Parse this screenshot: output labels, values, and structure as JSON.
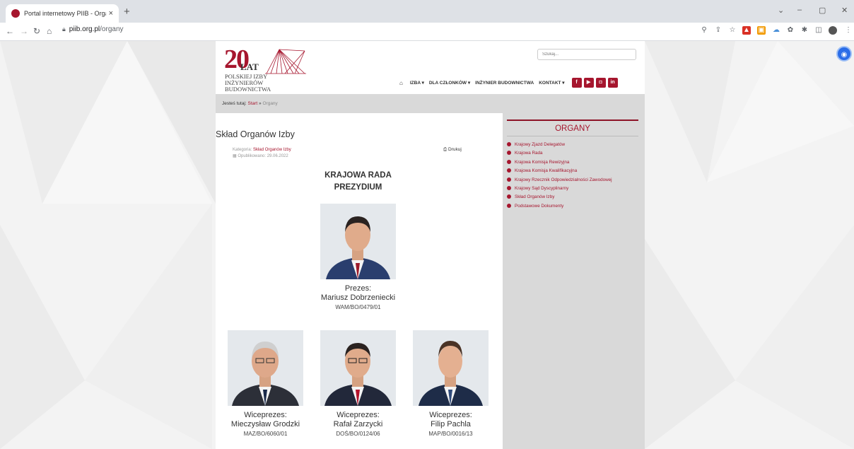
{
  "browser": {
    "tab_title": "Portal internetowy PIIB - Organy",
    "tab_close": "×",
    "new_tab": "+",
    "url_domain": "piib.org.pl",
    "url_path": "/organy"
  },
  "header": {
    "logo_number": "20",
    "logo_lat": "LAT",
    "logo_line1": "POLSKIEJ IZBY",
    "logo_line2": "INŻYNIERÓW BUDOWNICTWA",
    "search_placeholder": "Szukaj...",
    "nav": {
      "izba": "IZBA",
      "dla_czlonkow": "DLA CZŁONKÓW",
      "inzynier": "INŻYNIER BUDOWNICTWA",
      "kontakt": "KONTAKT"
    },
    "social": [
      "f",
      "▶",
      "◘",
      "in"
    ]
  },
  "breadcrumb": {
    "prefix": "Jesteś tutaj:",
    "start": "Start",
    "sep": "»",
    "current": "Organy"
  },
  "article": {
    "title": "Skład Organów Izby",
    "category_label": "Kategoria:",
    "category_value": "Skład Organów Izby",
    "published": "Opublikowano: 29.06.2022",
    "print": "Drukuj",
    "section_line1": "KRAJOWA RADA",
    "section_line2": "PREZYDIUM",
    "members": [
      {
        "role": "Prezes:",
        "name": "Mariusz Dobrzeniecki",
        "number": "WAM/BO/0479/01"
      },
      {
        "role": "Wiceprezes:",
        "name": "Mieczysław Grodzki",
        "number": "MAZ/BO/6060/01"
      },
      {
        "role": "Wiceprezes:",
        "name": "Rafał Zarzycki",
        "number": "DOŚ/BO/0124/06"
      },
      {
        "role": "Wiceprezes:",
        "name": "Filip Pachla",
        "number": "MAP/BO/0016/13"
      }
    ]
  },
  "sidebar": {
    "title": "ORGANY",
    "items": [
      "Krajowy Zjazd Delegatów",
      "Krajowa Rada",
      "Krajowa Komisja Rewizyjna",
      "Krajowa Komisja Kwalifikacyjna",
      "Krajowy Rzecznik Odpowiedzialności Zawodowej",
      "Krajowy Sąd Dyscyplinarny",
      "Skład Organów Izby",
      "Podstawowe Dokumenty"
    ]
  },
  "colors": {
    "brand": "#a6162e",
    "sidebar_bg": "#d9d9d9"
  }
}
